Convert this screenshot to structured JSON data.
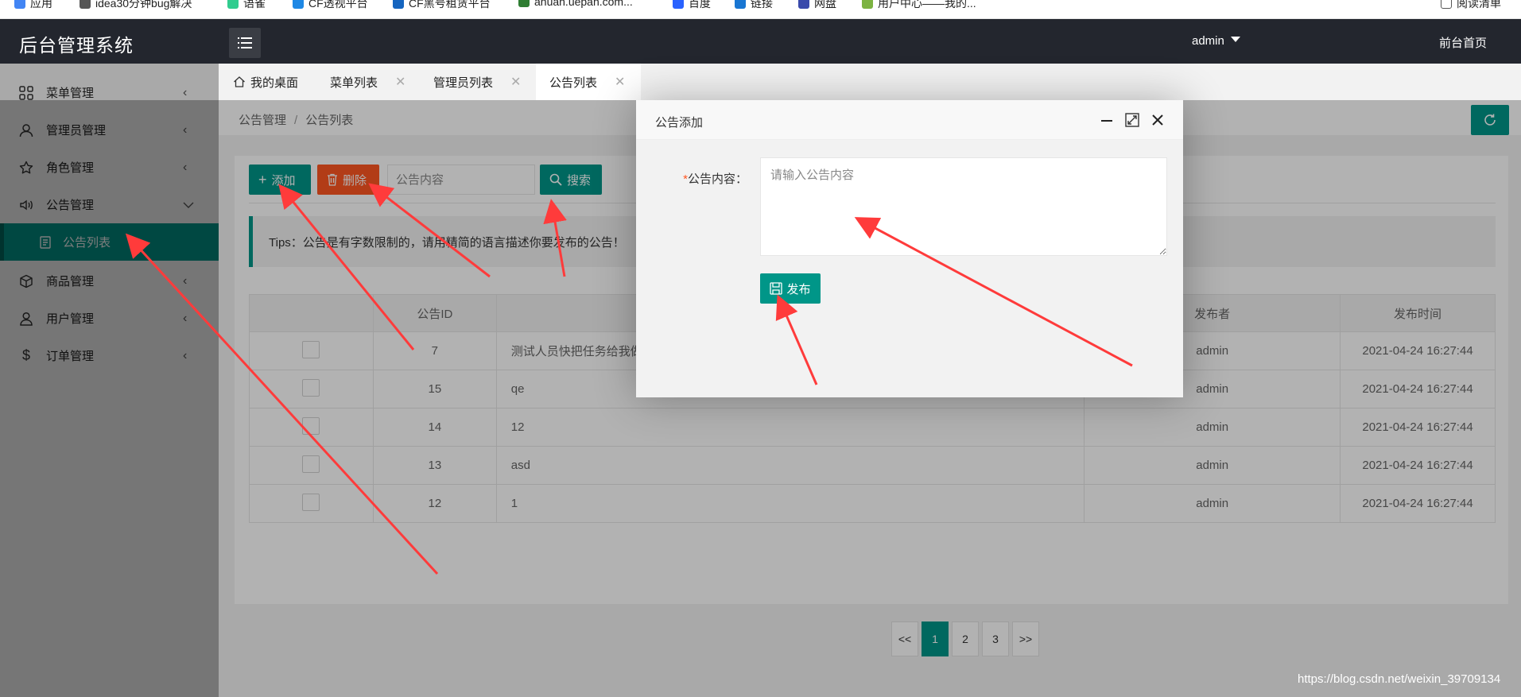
{
  "bookmarks": [
    {
      "label": "应用",
      "color": "#4285f4"
    },
    {
      "label": "idea30分钟bug解决",
      "color": "#555555"
    },
    {
      "label": "语雀",
      "color": "#31cc8f"
    },
    {
      "label": "CF透视平台",
      "color": "#1e88e5"
    },
    {
      "label": "CF黑号租赁平台",
      "color": "#1565c0"
    },
    {
      "label": "anuan.uepan.com...",
      "color": "#2e7d32"
    },
    {
      "label": "百度",
      "color": "#2962ff"
    },
    {
      "label": "链接",
      "color": "#1976d2"
    },
    {
      "label": "网盘",
      "color": "#3949ab"
    },
    {
      "label": "用户中心——我的...",
      "color": "#7cb342"
    },
    {
      "label": "阅读清单",
      "color": "#555555"
    }
  ],
  "header": {
    "app_title": "后台管理系统",
    "user": "admin",
    "home_link": "前台首页"
  },
  "sidebar": {
    "items": [
      {
        "label": "菜单管理",
        "icon": "grid-icon"
      },
      {
        "label": "管理员管理",
        "icon": "user-icon"
      },
      {
        "label": "角色管理",
        "icon": "star-icon"
      },
      {
        "label": "公告管理",
        "icon": "speaker-icon",
        "expanded": true
      },
      {
        "label": "公告列表",
        "icon": "document-icon",
        "active": true
      },
      {
        "label": "商品管理",
        "icon": "box-icon"
      },
      {
        "label": "用户管理",
        "icon": "person-icon"
      },
      {
        "label": "订单管理",
        "icon": "dollar-icon"
      }
    ]
  },
  "tabs": [
    {
      "label": "我的桌面",
      "closable": false
    },
    {
      "label": "菜单列表",
      "closable": true
    },
    {
      "label": "管理员列表",
      "closable": true
    },
    {
      "label": "公告列表",
      "closable": true,
      "active": true
    }
  ],
  "breadcrumb": {
    "parent": "公告管理",
    "separator": "/",
    "current": "公告列表"
  },
  "toolbar": {
    "add_label": "添加",
    "delete_label": "删除",
    "search_placeholder": "公告内容",
    "search_label": "搜索"
  },
  "tips": "Tips：公告是有字数限制的，请用精简的语言描述你要发布的公告！",
  "table": {
    "columns": [
      "",
      "公告ID",
      "",
      "发布者",
      "发布时间"
    ],
    "rows": [
      {
        "id": "7",
        "content": "测试人员快把任务给我做",
        "publisher": "admin",
        "time": "2021-04-24 16:27:44"
      },
      {
        "id": "15",
        "content": "qe",
        "publisher": "admin",
        "time": "2021-04-24 16:27:44"
      },
      {
        "id": "14",
        "content": "12",
        "publisher": "admin",
        "time": "2021-04-24 16:27:44"
      },
      {
        "id": "13",
        "content": "asd",
        "publisher": "admin",
        "time": "2021-04-24 16:27:44"
      },
      {
        "id": "12",
        "content": "1",
        "publisher": "admin",
        "time": "2021-04-24 16:27:44"
      }
    ]
  },
  "pagination": {
    "prev": "<<",
    "pages": [
      "1",
      "2",
      "3"
    ],
    "current": "1",
    "next": ">>"
  },
  "modal": {
    "title": "公告添加",
    "required_mark": "*",
    "field_label": "公告内容：",
    "placeholder": "请输入公告内容",
    "publish_label": "发布"
  },
  "watermark": "https://blog.csdn.net/weixin_39709134",
  "colors": {
    "primary": "#009688",
    "danger": "#ff5722",
    "header_bg": "#23262e",
    "annotation_arrow": "#ff3b3b"
  }
}
